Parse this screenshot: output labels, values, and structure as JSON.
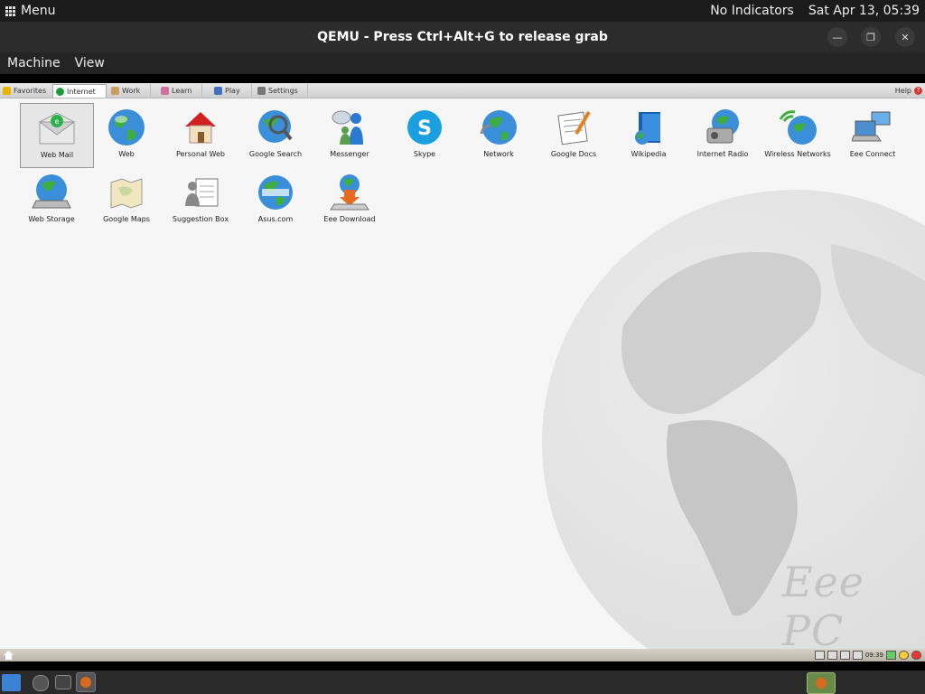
{
  "host_panel": {
    "menu_label": "Menu",
    "indicators": "No Indicators",
    "clock": "Sat Apr 13, 05:39"
  },
  "window": {
    "title": "QEMU - Press Ctrl+Alt+G to release grab",
    "minimize_glyph": "—",
    "maximize_glyph": "❐",
    "close_glyph": "✕"
  },
  "qemu_menu": [
    "Machine",
    "View"
  ],
  "guest": {
    "tabs": [
      {
        "label": "Favorites",
        "icon": "star-icon",
        "color": "#e8b400",
        "active": false
      },
      {
        "label": "Internet",
        "icon": "globe-icon",
        "color": "#1c9a3c",
        "active": true
      },
      {
        "label": "Work",
        "icon": "folder-icon",
        "color": "#c8a060",
        "active": false
      },
      {
        "label": "Learn",
        "icon": "book-icon",
        "color": "#d070a0",
        "active": false
      },
      {
        "label": "Play",
        "icon": "gamepad-icon",
        "color": "#4070c0",
        "active": false
      },
      {
        "label": "Settings",
        "icon": "wrench-icon",
        "color": "#777777",
        "active": false
      }
    ],
    "help_label": "Help",
    "help_glyph": "?",
    "apps_row1": [
      {
        "label": "Web Mail",
        "icon": "mail-icon",
        "selected": true
      },
      {
        "label": "Web",
        "icon": "globe-icon"
      },
      {
        "label": "Personal Web",
        "icon": "house-icon"
      },
      {
        "label": "Google Search",
        "icon": "magnifier-globe-icon"
      },
      {
        "label": "Messenger",
        "icon": "messenger-icon"
      },
      {
        "label": "Skype",
        "icon": "skype-icon"
      },
      {
        "label": "Network",
        "icon": "network-globe-icon"
      },
      {
        "label": "Google Docs",
        "icon": "document-pencil-icon"
      },
      {
        "label": "Wikipedia",
        "icon": "wikipedia-book-icon"
      },
      {
        "label": "Internet Radio",
        "icon": "radio-globe-icon"
      },
      {
        "label": "Wireless Networks",
        "icon": "wireless-globe-icon"
      },
      {
        "label": "Eee Connect",
        "icon": "laptops-icon"
      }
    ],
    "apps_row2": [
      {
        "label": "Web Storage",
        "icon": "storage-globe-icon"
      },
      {
        "label": "Google Maps",
        "icon": "map-icon"
      },
      {
        "label": "Suggestion Box",
        "icon": "suggestion-icon"
      },
      {
        "label": "Asus.com",
        "icon": "asus-globe-icon"
      },
      {
        "label": "Eee Download",
        "icon": "download-icon"
      }
    ],
    "logo_text": "Eee PC",
    "tray_time": "09:39"
  }
}
